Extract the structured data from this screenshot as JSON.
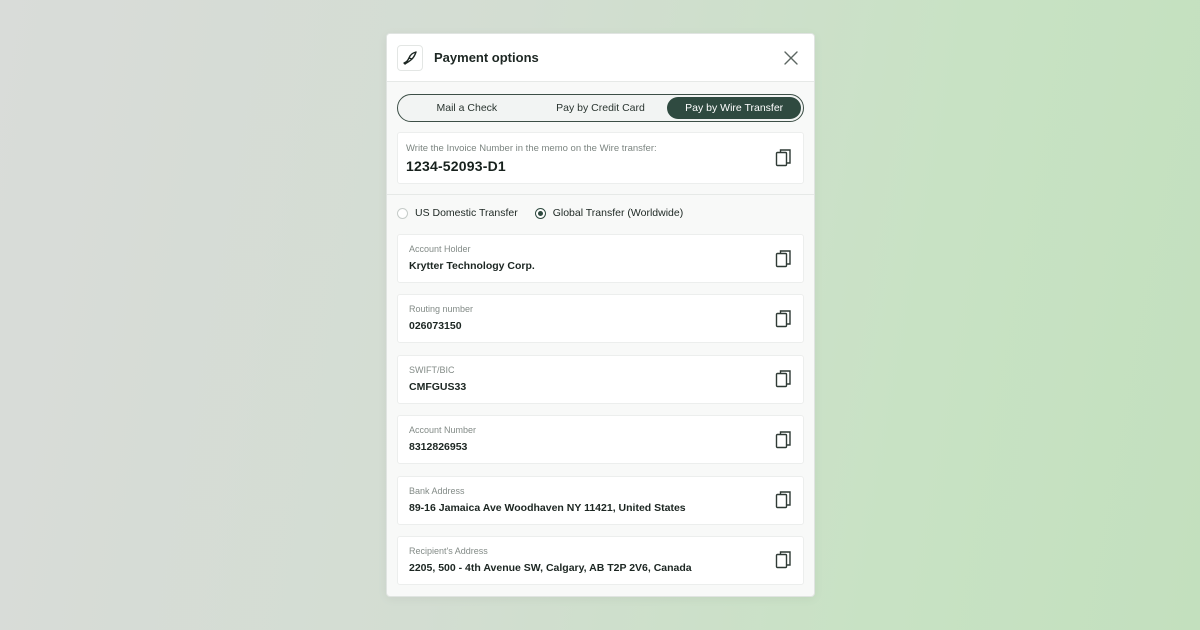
{
  "header": {
    "title": "Payment options",
    "logo_icon": "bird-logo-icon",
    "close_icon": "close-icon"
  },
  "tabs": [
    {
      "label": "Mail a Check",
      "active": false
    },
    {
      "label": "Pay by Credit Card",
      "active": false
    },
    {
      "label": "Pay by Wire Transfer",
      "active": true
    }
  ],
  "memo": {
    "label": "Write the Invoice Number in the memo on the Wire transfer:",
    "value": "1234-52093-D1"
  },
  "transfer_type": {
    "options": [
      {
        "label": "US Domestic Transfer",
        "checked": false
      },
      {
        "label": "Global Transfer (Worldwide)",
        "checked": true
      }
    ]
  },
  "fields": [
    {
      "label": "Account Holder",
      "value": "Krytter Technology Corp."
    },
    {
      "label": "Routing number",
      "value": "026073150"
    },
    {
      "label": "SWIFT/BIC",
      "value": "CMFGUS33"
    },
    {
      "label": "Account Number",
      "value": "8312826953"
    },
    {
      "label": "Bank Address",
      "value": "89-16 Jamaica Ave Woodhaven NY 11421, United States"
    },
    {
      "label": "Recipient's Address",
      "value": "2205, 500 - 4th Avenue SW, Calgary, AB T2P 2V6, Canada"
    }
  ],
  "colors": {
    "accent": "#2f4a40",
    "panel": "#ffffff"
  }
}
